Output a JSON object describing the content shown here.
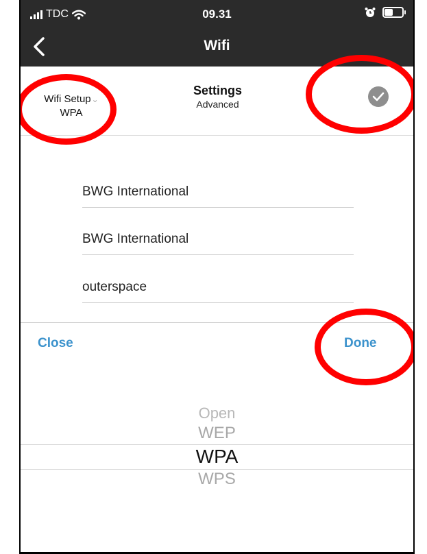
{
  "status_bar": {
    "carrier": "TDC",
    "time": "09.31",
    "signal_icon": "signal-bars-icon",
    "wifi_icon": "wifi-icon",
    "alarm_icon": "alarm-clock-icon",
    "battery_icon": "battery-icon",
    "battery_level": 0.45
  },
  "nav": {
    "title": "Wifi",
    "back_icon": "chevron-left-icon"
  },
  "header": {
    "setup_label": "Wifi Setup",
    "setup_value": "WPA",
    "settings_title": "Settings",
    "settings_sub": "Advanced",
    "confirm_icon": "checkmark-icon"
  },
  "fields": {
    "network_name": "BWG International",
    "ssid": "BWG International",
    "password": "outerspace"
  },
  "picker_toolbar": {
    "close_label": "Close",
    "done_label": "Done"
  },
  "picker": {
    "options": [
      "Open",
      "WEP",
      "WPA",
      "WPS"
    ],
    "selected": "WPA"
  },
  "colors": {
    "header_bg": "#2b2b2b",
    "accent": "#3b92cc",
    "annotation": "#ff0000"
  }
}
